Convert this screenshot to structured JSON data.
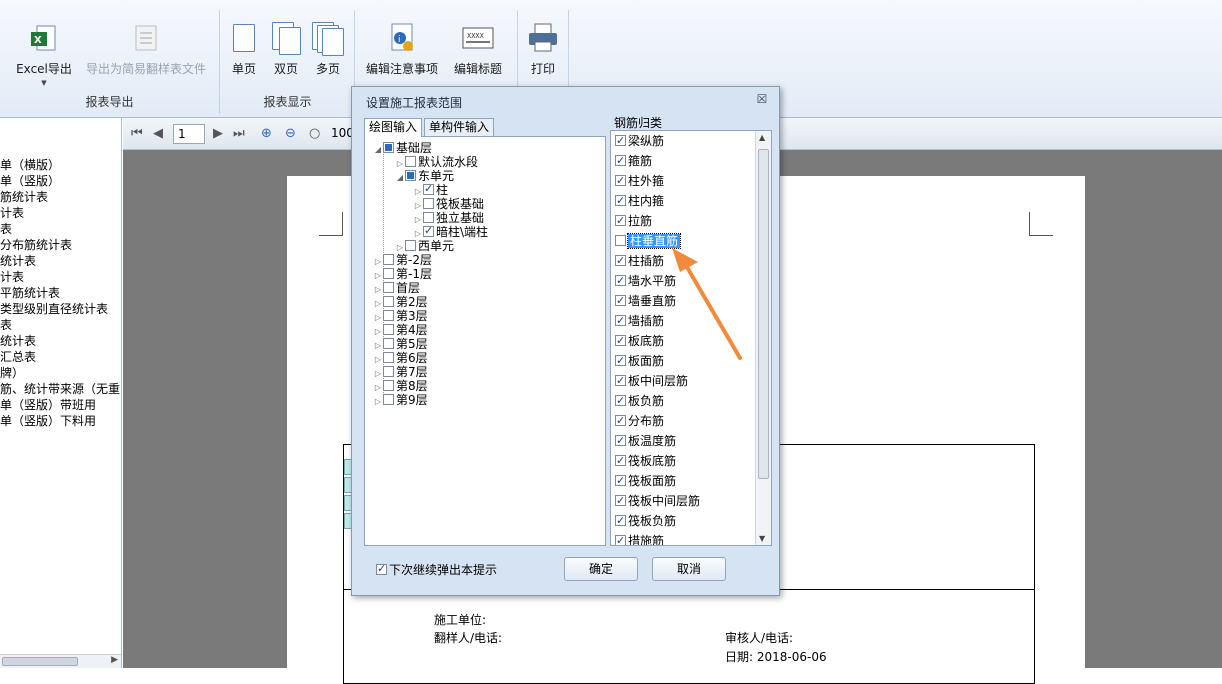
{
  "ribbon": {
    "groups": [
      {
        "label": "报表导出",
        "buttons": [
          "Excel导出",
          "导出为简易翻样表文件"
        ]
      },
      {
        "label": "报表显示",
        "buttons": [
          "单页",
          "双页",
          "多页"
        ]
      },
      {
        "label": "",
        "buttons": [
          "编辑注意事项",
          "编辑标题"
        ]
      },
      {
        "label": "",
        "buttons": [
          "打印"
        ]
      }
    ]
  },
  "left_panel": {
    "items": [
      "单（横版）",
      "单（竖版）",
      "筋统计表",
      "计表",
      "表",
      "分布筋统计表",
      "统计表",
      "计表",
      "平筋统计表",
      "类型级别直径统计表",
      "表",
      "统计表",
      "汇总表",
      "牌）",
      "筋、统计带来源（无重",
      "单（竖版）带班用",
      "单（竖版）下料用"
    ]
  },
  "preview": {
    "page_number": "1",
    "zoom": "100",
    "footer": {
      "company": "施工单位:",
      "translator": "翻样人/电话:",
      "reviewer": "审核人/电话:",
      "date": "日期: 2018-06-06"
    }
  },
  "dialog": {
    "title": "设置施工报表范围",
    "close": "☒",
    "tabs": [
      "绘图输入",
      "单构件输入"
    ],
    "tree": [
      {
        "label": "基础层",
        "state": "partial",
        "level": 0,
        "expanded": true
      },
      {
        "label": "默认流水段",
        "state": "off",
        "level": 1
      },
      {
        "label": "东单元",
        "state": "partial",
        "level": 1,
        "expanded": true
      },
      {
        "label": "柱",
        "state": "on",
        "level": 2
      },
      {
        "label": "筏板基础",
        "state": "off",
        "level": 2
      },
      {
        "label": "独立基础",
        "state": "off",
        "level": 2
      },
      {
        "label": "暗柱\\端柱",
        "state": "on",
        "level": 2
      },
      {
        "label": "西单元",
        "state": "off",
        "level": 1
      },
      {
        "label": "第-2层",
        "state": "off",
        "level": 0
      },
      {
        "label": "第-1层",
        "state": "off",
        "level": 0
      },
      {
        "label": "首层",
        "state": "off",
        "level": 0
      },
      {
        "label": "第2层",
        "state": "off",
        "level": 0
      },
      {
        "label": "第3层",
        "state": "off",
        "level": 0
      },
      {
        "label": "第4层",
        "state": "off",
        "level": 0
      },
      {
        "label": "第5层",
        "state": "off",
        "level": 0
      },
      {
        "label": "第6层",
        "state": "off",
        "level": 0
      },
      {
        "label": "第7层",
        "state": "off",
        "level": 0
      },
      {
        "label": "第8层",
        "state": "off",
        "level": 0
      },
      {
        "label": "第9层",
        "state": "off",
        "level": 0
      }
    ],
    "rebar_label": "钢筋归类",
    "rebar_items": [
      {
        "label": "梁纵筋",
        "checked": true
      },
      {
        "label": "箍筋",
        "checked": true
      },
      {
        "label": "柱外箍",
        "checked": true
      },
      {
        "label": "柱内箍",
        "checked": true
      },
      {
        "label": "拉筋",
        "checked": true
      },
      {
        "label": "柱垂直筋",
        "checked": false,
        "selected": true
      },
      {
        "label": "柱插筋",
        "checked": true
      },
      {
        "label": "墙水平筋",
        "checked": true
      },
      {
        "label": "墙垂直筋",
        "checked": true
      },
      {
        "label": "墙插筋",
        "checked": true
      },
      {
        "label": "板底筋",
        "checked": true
      },
      {
        "label": "板面筋",
        "checked": true
      },
      {
        "label": "板中间层筋",
        "checked": true
      },
      {
        "label": "板负筋",
        "checked": true
      },
      {
        "label": "分布筋",
        "checked": true
      },
      {
        "label": "板温度筋",
        "checked": true
      },
      {
        "label": "筏板底筋",
        "checked": true
      },
      {
        "label": "筏板面筋",
        "checked": true
      },
      {
        "label": "筏板中间层筋",
        "checked": true
      },
      {
        "label": "筏板负筋",
        "checked": true
      },
      {
        "label": "措施筋",
        "checked": true
      }
    ],
    "next_prompt": "下次继续弹出本提示",
    "ok": "确定",
    "cancel": "取消"
  },
  "colors": {
    "accent": "#3399ff",
    "arrow": "#f08a3c",
    "dialog_bg": "#d6e3f3"
  }
}
